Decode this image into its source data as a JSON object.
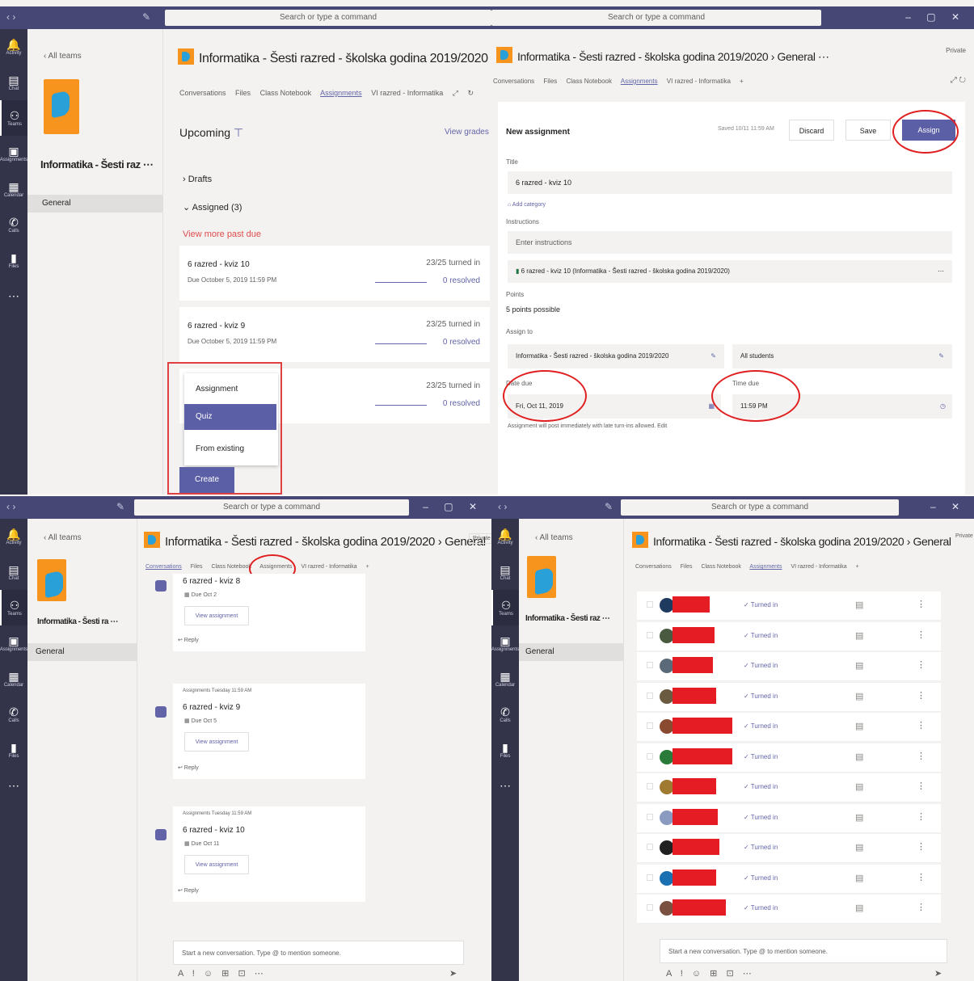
{
  "q1": {
    "search": "Search or type a command",
    "rail": [
      {
        "icon": "🔔",
        "label": "Activity"
      },
      {
        "icon": "▤",
        "label": "Chat"
      },
      {
        "icon": "⚇",
        "label": "Teams"
      },
      {
        "icon": "▣",
        "label": "Assignments"
      },
      {
        "icon": "▦",
        "label": "Calendar"
      },
      {
        "icon": "✆",
        "label": "Calls"
      },
      {
        "icon": "▮",
        "label": "Files"
      },
      {
        "icon": "⋯",
        "label": ""
      }
    ],
    "all_teams": "‹ All teams",
    "team_name": "Informatika - Šesti raz ⋯",
    "general": "General",
    "header": "Informatika - Šesti razred - školska godina 2019/2020",
    "tabs": [
      "Conversations",
      "Files",
      "Class Notebook",
      "Assignments",
      "VI razred - Informatika",
      "⤢",
      "↻"
    ],
    "upcoming": "Upcoming",
    "view_grades": "View grades",
    "drafts": "Drafts",
    "assigned": "Assigned (3)",
    "view_more": "View more past due",
    "assignments": [
      {
        "title": "6 razred - kviz 10",
        "due": "Due October 5, 2019 11:59 PM",
        "turned": "23/25 turned in",
        "status": "0 resolved"
      },
      {
        "title": "6 razred - kviz 9",
        "due": "Due October 5, 2019 11:59 PM",
        "turned": "23/25 turned in",
        "status": "0 resolved"
      },
      {
        "title": "",
        "due": "",
        "turned": "23/25 turned in",
        "status": "0 resolved"
      }
    ],
    "menu": {
      "assignment": "Assignment",
      "quiz": "Quiz",
      "from_existing": "From existing",
      "create": "Create"
    }
  },
  "q2": {
    "search": "Search or type a command",
    "header": "Informatika - Šesti razred - školska godina 2019/2020 › General ⋯",
    "tabs": [
      "Conversations",
      "Files",
      "Class Notebook",
      "Assignments",
      "VI razred - Informatika",
      "+"
    ],
    "private_btn": "Private",
    "new_assignment": "New assignment",
    "saved": "Saved 10/11 11:59 AM",
    "discard": "Discard",
    "save": "Save",
    "assign": "Assign",
    "title_label": "Title",
    "title_value": "6 razred - kviz 10",
    "add_category": "Add category",
    "instructions_label": "Instructions",
    "instructions_placeholder": "Enter instructions",
    "resource": "6 razred - kviz 10 (Informatika - Šesti razred - školska godina 2019/2020)",
    "points_label": "Points",
    "points_value": "5 points possible",
    "assign_to_label": "Assign to",
    "class_value": "Informatika - Šesti razred - školska godina 2019/2020",
    "students_value": "All students",
    "date_due_label": "Date due",
    "date_value": "Fri, Oct 11, 2019",
    "time_due_label": "Time due",
    "time_value": "11:59 PM",
    "note": "Assignment will post immediately with late turn-ins allowed. Edit"
  },
  "q3": {
    "search": "Search or type a command",
    "all_teams": "‹ All teams",
    "team_name": "Informatika - Šesti ra ⋯",
    "general": "General",
    "header": "Informatika - Šesti razred - školska godina 2019/2020 › General",
    "tabs": [
      "Conversations",
      "Files",
      "Class Notebook",
      "Assignments",
      "VI razred - Informatika",
      "+"
    ],
    "private_btn": "Private",
    "posts": [
      {
        "meta": "",
        "title": "6 razred - kviz 8",
        "due": "Due Oct 2",
        "button": "View assignment",
        "reply": "↩ Reply"
      },
      {
        "meta": "Assignments  Tuesday 11:59 AM",
        "title": "6 razred - kviz 9",
        "due": "Due Oct 5",
        "button": "View assignment",
        "reply": "↩ Reply"
      },
      {
        "meta": "Assignments  Tuesday 11:59 AM",
        "title": "6 razred - kviz 10",
        "due": "Due Oct 11",
        "button": "View assignment",
        "reply": "↩ Reply"
      }
    ],
    "compose": "Start a new conversation. Type @ to mention someone.",
    "tools": "A ! ☺ ⊞ ⊡ ⋯"
  },
  "q4": {
    "search": "Search or type a command",
    "all_teams": "‹ All teams",
    "team_name": "Informatika - Šesti raz ⋯",
    "general": "General",
    "header": "Informatika - Šesti razred - školska godina 2019/2020 › General",
    "tabs": [
      "Conversations",
      "Files",
      "Class Notebook",
      "Assignments",
      "VI razred - Informatika",
      "+"
    ],
    "private_btn": "Private",
    "status_label": "✓ Turned in",
    "students": [
      {
        "av": "#1f3a5f",
        "w": 46
      },
      {
        "av": "#4a5a40",
        "w": 52
      },
      {
        "av": "#5a6a78",
        "w": 50
      },
      {
        "av": "#6a5a40",
        "w": 54
      },
      {
        "av": "#8a4a30",
        "w": 74
      },
      {
        "av": "#2a7a3a",
        "w": 74
      },
      {
        "av": "#a07a30",
        "w": 54
      },
      {
        "av": "#8a9ac0",
        "w": 56
      },
      {
        "av": "#202020",
        "w": 58
      },
      {
        "av": "#1a70b0",
        "w": 54
      },
      {
        "av": "#7a5040",
        "w": 66
      }
    ],
    "compose": "Start a new conversation. Type @ to mention someone.",
    "tools": "A ! ☺ ⊞ ⊡ ⋯"
  }
}
